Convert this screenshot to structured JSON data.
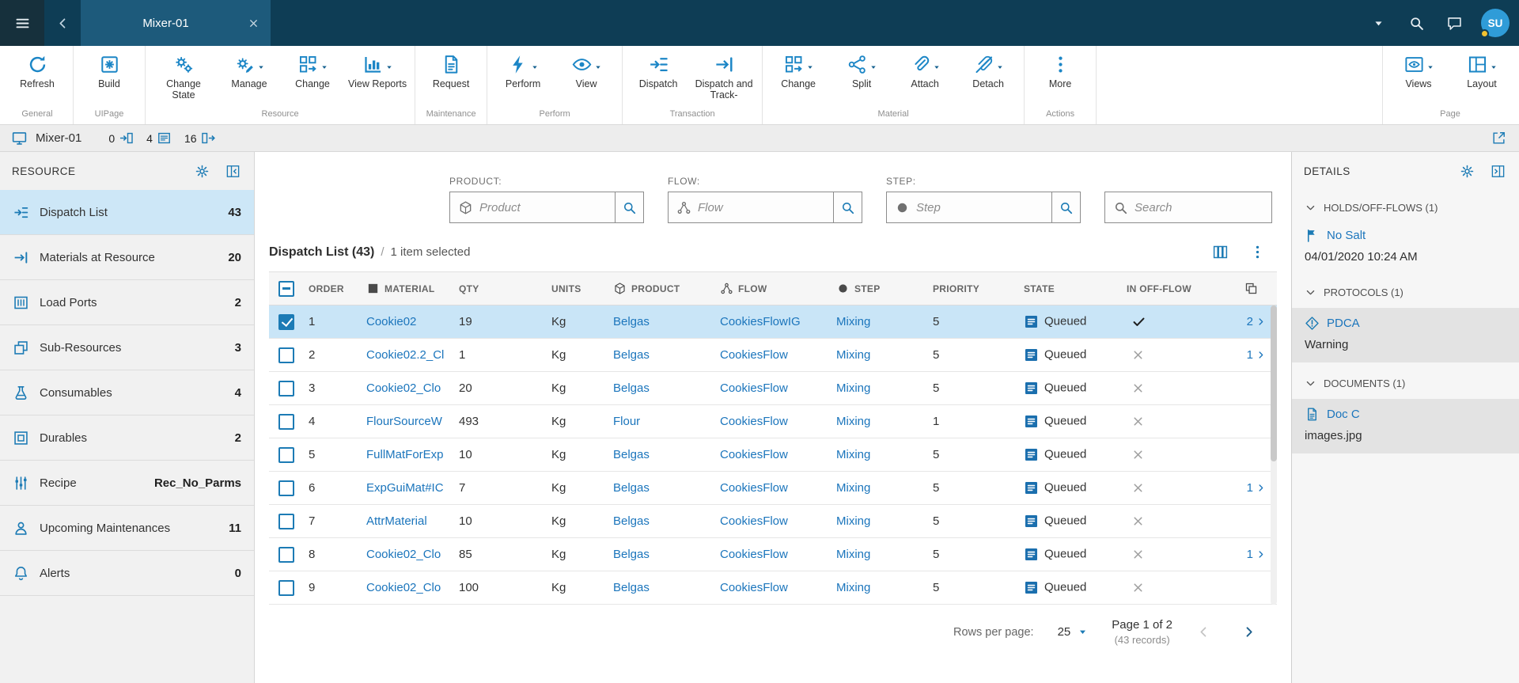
{
  "colors": {
    "topbar_bg": "#0E3D55",
    "tab_bg": "#1D5A7B",
    "accent_blue": "#1C86C6",
    "link_blue": "#1B75BC",
    "selected_row_bg": "#C9E5F7",
    "sidebar_selected_bg": "#CDE7F7",
    "state_icon_blue": "#1B6FAE",
    "status_dot_yellow": "#F2C230"
  },
  "topbar": {
    "tab_title": "Mixer-01",
    "user_initials": "SU"
  },
  "ribbon": {
    "groups": [
      {
        "name": "General",
        "buttons": [
          {
            "label": "Refresh",
            "icon": "refresh-icon",
            "caret": false
          }
        ]
      },
      {
        "name": "UIPage",
        "buttons": [
          {
            "label": "Build",
            "icon": "build-icon",
            "caret": false
          }
        ]
      },
      {
        "name": "Resource",
        "buttons": [
          {
            "label": "Change State",
            "icon": "change-state-icon",
            "caret": false
          },
          {
            "label": "Manage",
            "icon": "manage-icon",
            "caret": true
          },
          {
            "label": "Change",
            "icon": "change-icon",
            "caret": true
          },
          {
            "label": "View Reports",
            "icon": "view-reports-icon",
            "caret": true
          }
        ]
      },
      {
        "name": "Maintenance",
        "buttons": [
          {
            "label": "Request",
            "icon": "request-icon",
            "caret": false
          }
        ]
      },
      {
        "name": "Perform",
        "buttons": [
          {
            "label": "Perform",
            "icon": "perform-icon",
            "caret": true
          },
          {
            "label": "View",
            "icon": "view-icon",
            "caret": true
          }
        ]
      },
      {
        "name": "Transaction",
        "buttons": [
          {
            "label": "Dispatch",
            "icon": "dispatch-icon",
            "caret": false
          },
          {
            "label": "Dispatch and Track-",
            "icon": "dispatch-track-icon",
            "caret": false
          }
        ]
      },
      {
        "name": "Material",
        "buttons": [
          {
            "label": "Change",
            "icon": "change-icon",
            "caret": true
          },
          {
            "label": "Split",
            "icon": "split-icon",
            "caret": true
          },
          {
            "label": "Attach",
            "icon": "attach-icon",
            "caret": true
          },
          {
            "label": "Detach",
            "icon": "detach-icon",
            "caret": true
          }
        ]
      },
      {
        "name": "Actions",
        "buttons": [
          {
            "label": "More",
            "icon": "more-icon",
            "caret": false
          }
        ]
      },
      {
        "name": "Page",
        "right": true,
        "buttons": [
          {
            "label": "Views",
            "icon": "views-icon",
            "caret": true
          },
          {
            "label": "Layout",
            "icon": "layout-icon",
            "caret": true
          }
        ]
      }
    ]
  },
  "breadcrumb": {
    "title": "Mixer-01",
    "counts": [
      {
        "value": "0",
        "icon": "count-in-icon"
      },
      {
        "value": "4",
        "icon": "count-queued-icon"
      },
      {
        "value": "16",
        "icon": "count-out-icon"
      }
    ]
  },
  "sidebar": {
    "title": "RESOURCE",
    "items": [
      {
        "label": "Dispatch List",
        "value": "43",
        "icon": "dispatch-icon",
        "selected": true
      },
      {
        "label": "Materials at Resource",
        "value": "20",
        "icon": "materials-icon"
      },
      {
        "label": "Load Ports",
        "value": "2",
        "icon": "load-ports-icon"
      },
      {
        "label": "Sub-Resources",
        "value": "3",
        "icon": "sub-resources-icon"
      },
      {
        "label": "Consumables",
        "value": "4",
        "icon": "consumables-icon"
      },
      {
        "label": "Durables",
        "value": "2",
        "icon": "durables-icon"
      },
      {
        "label": "Recipe",
        "value": "Rec_No_Parms",
        "icon": "recipe-icon"
      },
      {
        "label": "Upcoming Maintenances",
        "value": "11",
        "icon": "maintenance-icon"
      },
      {
        "label": "Alerts",
        "value": "0",
        "icon": "bell-icon"
      }
    ]
  },
  "filters": [
    {
      "label": "PRODUCT:",
      "placeholder": "Product",
      "icon": "product-icon"
    },
    {
      "label": "FLOW:",
      "placeholder": "Flow",
      "icon": "flow-icon"
    },
    {
      "label": "STEP:",
      "placeholder": "Step",
      "icon": "step-icon"
    }
  ],
  "search": {
    "placeholder": "Search"
  },
  "list": {
    "title": "Dispatch List (43)",
    "sep": "/",
    "selection_note": "1 item selected",
    "columns": [
      {
        "label": "ORDER"
      },
      {
        "label": "MATERIAL",
        "icon": "material-icon"
      },
      {
        "label": "QTY"
      },
      {
        "label": "UNITS"
      },
      {
        "label": "PRODUCT",
        "icon": "product-icon"
      },
      {
        "label": "FLOW",
        "icon": "flow-icon"
      },
      {
        "label": "STEP",
        "icon": "step-icon"
      },
      {
        "label": "PRIORITY"
      },
      {
        "label": "STATE"
      },
      {
        "label": "IN OFF-FLOW"
      }
    ],
    "rows": [
      {
        "order": "1",
        "material": "Cookie02",
        "qty": "19",
        "units": "Kg",
        "product": "Belgas",
        "flow": "CookiesFlowIG",
        "step": "Mixing",
        "priority": "5",
        "state": "Queued",
        "selected": true,
        "off_flow": true,
        "has_link": true,
        "link_count": "2"
      },
      {
        "order": "2",
        "material": "Cookie02.2_Cl",
        "qty": "1",
        "units": "Kg",
        "product": "Belgas",
        "flow": "CookiesFlow",
        "step": "Mixing",
        "priority": "5",
        "state": "Queued",
        "has_link": true,
        "link_count": "1"
      },
      {
        "order": "3",
        "material": "Cookie02_Clo",
        "qty": "20",
        "units": "Kg",
        "product": "Belgas",
        "flow": "CookiesFlow",
        "step": "Mixing",
        "priority": "5",
        "state": "Queued"
      },
      {
        "order": "4",
        "material": "FlourSourceW",
        "qty": "493",
        "units": "Kg",
        "product": "Flour",
        "flow": "CookiesFlow",
        "step": "Mixing",
        "priority": "1",
        "state": "Queued"
      },
      {
        "order": "5",
        "material": "FullMatForExp",
        "qty": "10",
        "units": "Kg",
        "product": "Belgas",
        "flow": "CookiesFlow",
        "step": "Mixing",
        "priority": "5",
        "state": "Queued"
      },
      {
        "order": "6",
        "material": "ExpGuiMat#IC",
        "qty": "7",
        "units": "Kg",
        "product": "Belgas",
        "flow": "CookiesFlow",
        "step": "Mixing",
        "priority": "5",
        "state": "Queued",
        "has_link": true,
        "link_count": "1"
      },
      {
        "order": "7",
        "material": "AttrMaterial",
        "qty": "10",
        "units": "Kg",
        "product": "Belgas",
        "flow": "CookiesFlow",
        "step": "Mixing",
        "priority": "5",
        "state": "Queued"
      },
      {
        "order": "8",
        "material": "Cookie02_Clo",
        "qty": "85",
        "units": "Kg",
        "product": "Belgas",
        "flow": "CookiesFlow",
        "step": "Mixing",
        "priority": "5",
        "state": "Queued",
        "has_link": true,
        "link_count": "1"
      },
      {
        "order": "9",
        "material": "Cookie02_Clo",
        "qty": "100",
        "units": "Kg",
        "product": "Belgas",
        "flow": "CookiesFlow",
        "step": "Mixing",
        "priority": "5",
        "state": "Queued"
      }
    ]
  },
  "pagination": {
    "rows_per_page_label": "Rows per page:",
    "rows_per_page": "25",
    "page_label": "Page 1 of 2",
    "records_label": "(43 records)"
  },
  "details": {
    "title": "DETAILS",
    "sections": [
      {
        "title": "HOLDS/OFF-FLOWS (1)",
        "items": [
          {
            "icon": "flag-icon",
            "item_title": "No Salt",
            "item_sub": "04/01/2020 10:24 AM",
            "shaded": false
          }
        ]
      },
      {
        "title": "PROTOCOLS (1)",
        "items": [
          {
            "icon": "warning-icon",
            "item_title": "PDCA",
            "item_sub": "Warning",
            "shaded": true
          }
        ]
      },
      {
        "title": "DOCUMENTS (1)",
        "items": [
          {
            "icon": "doc-icon",
            "item_title": "Doc C",
            "item_sub": "images.jpg",
            "shaded": true
          }
        ]
      }
    ]
  }
}
